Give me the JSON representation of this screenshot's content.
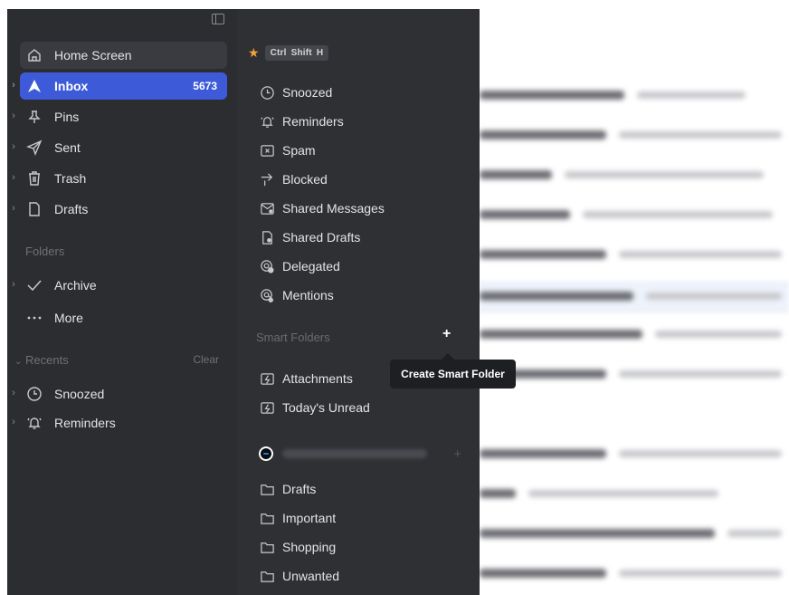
{
  "sidebar": {
    "items": [
      {
        "label": "Home Screen",
        "icon": "home-icon"
      },
      {
        "label": "Inbox",
        "icon": "inbox-arrow-icon",
        "count": "5673",
        "active": true
      },
      {
        "label": "Pins",
        "icon": "pin-icon"
      },
      {
        "label": "Sent",
        "icon": "send-icon"
      },
      {
        "label": "Trash",
        "icon": "trash-icon"
      },
      {
        "label": "Drafts",
        "icon": "draft-icon"
      }
    ],
    "folders_label": "Folders",
    "folders": [
      {
        "label": "Archive",
        "icon": "check-icon"
      },
      {
        "label": "More",
        "icon": "more-dots-icon"
      }
    ],
    "recents_label": "Recents",
    "recents_clear": "Clear",
    "recents": [
      {
        "label": "Snoozed",
        "icon": "clock-icon"
      },
      {
        "label": "Reminders",
        "icon": "bell-icon"
      }
    ]
  },
  "menu": {
    "shortcut_keys": [
      "Ctrl",
      "Shift",
      "H"
    ],
    "items": [
      {
        "label": "Snoozed",
        "icon": "clock-icon"
      },
      {
        "label": "Reminders",
        "icon": "bell-icon"
      },
      {
        "label": "Spam",
        "icon": "spam-icon"
      },
      {
        "label": "Blocked",
        "icon": "blocked-icon"
      },
      {
        "label": "Shared Messages",
        "icon": "shared-messages-icon"
      },
      {
        "label": "Shared Drafts",
        "icon": "shared-drafts-icon"
      },
      {
        "label": "Delegated",
        "icon": "delegated-icon"
      },
      {
        "label": "Mentions",
        "icon": "mention-icon"
      }
    ],
    "smart_folders_label": "Smart Folders",
    "smart_folders": [
      {
        "label": "Attachments",
        "icon": "smart-folder-icon"
      },
      {
        "label": "Today's Unread",
        "icon": "smart-folder-icon"
      }
    ],
    "account_folders": [
      {
        "label": "Drafts",
        "icon": "folder-icon"
      },
      {
        "label": "Important",
        "icon": "folder-icon"
      },
      {
        "label": "Shopping",
        "icon": "folder-icon"
      },
      {
        "label": "Unwanted",
        "icon": "folder-icon"
      }
    ]
  },
  "tooltip": {
    "text": "Create Smart Folder"
  },
  "colors": {
    "accent": "#3d5bd9",
    "star": "#f2a33a",
    "sidebar_bg": "#2c2d31",
    "menu_bg": "#2f3034"
  }
}
